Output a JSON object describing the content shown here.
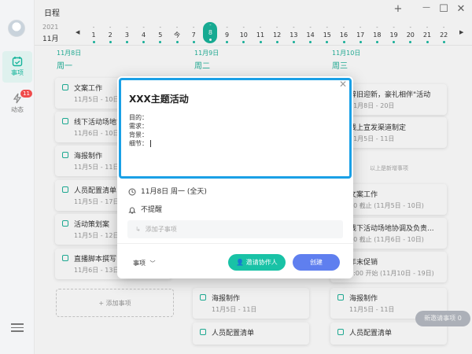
{
  "app": {
    "title": "日程"
  },
  "window": {
    "add": "+",
    "minimize": "—",
    "maximize": "☐",
    "close": "✕"
  },
  "sidebar": {
    "items": [
      {
        "label": "事项",
        "active": true
      },
      {
        "label": "动态",
        "badge": "11"
      }
    ]
  },
  "datebar": {
    "year": "2021",
    "month": "11月",
    "prev": "◀",
    "next": "▶",
    "days": [
      {
        "num": "1"
      },
      {
        "num": "2"
      },
      {
        "num": "3"
      },
      {
        "num": "4"
      },
      {
        "num": "5"
      },
      {
        "num": "今"
      },
      {
        "num": "7"
      },
      {
        "num": "8",
        "selected": true
      },
      {
        "num": "9"
      },
      {
        "num": "10"
      },
      {
        "num": "11"
      },
      {
        "num": "12"
      },
      {
        "num": "13"
      },
      {
        "num": "14"
      },
      {
        "num": "15"
      },
      {
        "num": "16"
      },
      {
        "num": "17"
      },
      {
        "num": "18"
      },
      {
        "num": "19"
      },
      {
        "num": "20"
      },
      {
        "num": "21"
      },
      {
        "num": "22"
      }
    ]
  },
  "columns": [
    {
      "date": "11月8日",
      "weekday": "周一",
      "cards": [
        {
          "title": "文案工作",
          "date": "11月5日 - 10日"
        },
        {
          "title": "线下活动场地协",
          "date": "11月6日 - 10日"
        },
        {
          "title": "海报制作",
          "date": "11月5日 - 11日"
        },
        {
          "title": "人员配置清单",
          "date": "11月5日 - 17日"
        },
        {
          "title": "活动策划案",
          "date": "11月5日 - 12日"
        },
        {
          "title": "直播脚本撰写",
          "date": "11月6日 - 13日"
        }
      ],
      "add_label": "+ 添加事项"
    },
    {
      "date": "11月9日",
      "weekday": "周二",
      "cards": [
        {
          "title": "海报制作",
          "date": "11月5日 - 11日"
        },
        {
          "title": "人员配置清单",
          "date": ""
        }
      ]
    },
    {
      "date": "11月10日",
      "weekday": "周三",
      "cards": [
        {
          "title": "辞旧迎新，豪礼相伴\"活动",
          "date": "11月8日 - 20日"
        },
        {
          "title": "线上宣发渠道制定",
          "date": "11月5日 - 11日"
        },
        {
          "title": "文案工作",
          "date": "00 截止 (11月5日 - 10日)"
        },
        {
          "title": "线下活动场地协调及负责...",
          "date": "00 截止 (11月6日 - 10日)"
        },
        {
          "title": "年末促销",
          "date": "7:00 开始 (11月10日 - 19日)"
        },
        {
          "title": "海报制作",
          "date": "11月5日 - 11日"
        },
        {
          "title": "人员配置清单",
          "date": ""
        }
      ],
      "divider": "以上是新增事项"
    }
  ],
  "new_pill": "新邀请事项 0",
  "modal": {
    "title": "XXX主题活动",
    "lines": [
      "目的：",
      "需求：",
      "背景：",
      "细节："
    ],
    "date_text": "11月8日 周一 (全天)",
    "reminder_text": "不提醒",
    "subtask_placeholder": "添加子事项",
    "type_label": "事项",
    "invite_label": "邀请协作人",
    "create_label": "创建"
  },
  "colors": {
    "accent": "#19b59c",
    "create": "#5f7fef",
    "focus": "#1aa0e6"
  }
}
